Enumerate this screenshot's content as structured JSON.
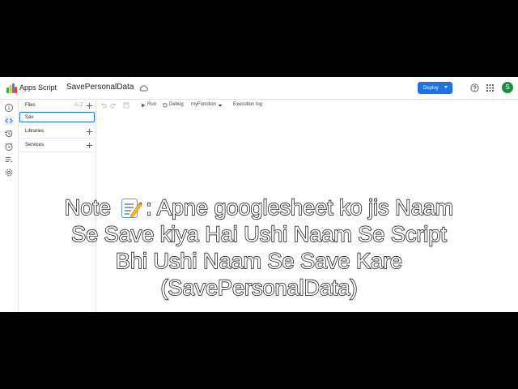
{
  "header": {
    "product_name": "Apps Script",
    "project_title": "SavePersonalData",
    "deploy_label": "Deploy",
    "avatar_initial": "S"
  },
  "files_panel": {
    "files_label": "Files",
    "sort_label": "A↓Z",
    "new_file_value": "Sav",
    "libraries_label": "Libraries",
    "services_label": "Services"
  },
  "toolbar": {
    "run_label": "Run",
    "debug_label": "Debug",
    "function_select": "myFunction",
    "execution_log_label": "Execution log"
  },
  "overlay": {
    "line1_prefix": "Note ",
    "line1_suffix": ": Apne googlesheet ko jis Naam",
    "line2": "Se Save kiya Hai Ushi Naam Se Script",
    "line3": "Bhi Ushi Naam Se Save Kare",
    "line4": "(SavePersonalData)"
  },
  "colors": {
    "accent": "#1a73e8",
    "avatar_bg": "#1e8e3e",
    "letterbox": "#000000"
  },
  "icons": [
    "apps-script-logo-icon",
    "cloud-icon",
    "help-icon",
    "apps-grid-icon",
    "info-icon",
    "code-icon",
    "history-icon",
    "clock-icon",
    "executions-icon",
    "settings-icon",
    "sort-icon",
    "plus-icon",
    "undo-icon",
    "redo-icon",
    "save-icon",
    "run-icon",
    "debug-icon",
    "memo-icon"
  ]
}
